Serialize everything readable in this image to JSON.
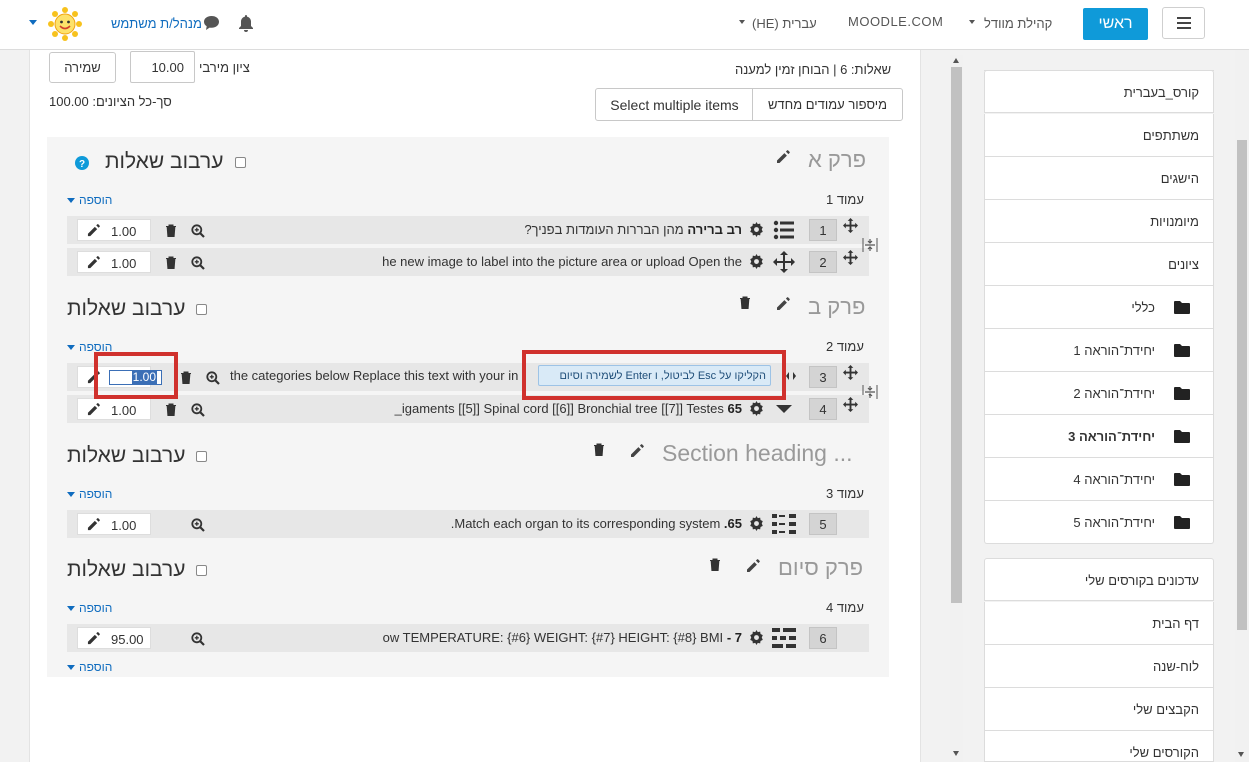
{
  "navbar": {
    "home": "ראשי",
    "community": "קהילת מוודל",
    "moodle_com": "MOODLE.COM",
    "language": "עברית (HE)",
    "user_name": "מנהל/ת משתמש"
  },
  "header": {
    "max_grade_label": "ציון מירבי",
    "max_grade_value": "10.00",
    "save_button": "שמירה",
    "questions_info": "שאלות: 6 | הבוחן זמין למענה",
    "total_marks": "סך-כל הציונים: 100.00",
    "repaginate_button": "מיספור עמודים מחדש",
    "select_multiple_button": "Select multiple items"
  },
  "shuffle_label": "ערבוב שאלות",
  "add_label": "הוספה",
  "sections": [
    {
      "title": "פרק א",
      "page": "עמוד 1"
    },
    {
      "title": "פרק ב",
      "page": "עמוד 2"
    },
    {
      "title": "Section heading ...",
      "page": "עמוד 3"
    },
    {
      "title": "פרק סיום",
      "page": "עמוד 4"
    }
  ],
  "questions": [
    {
      "num": "1",
      "name": "רב ברירה",
      "text": "מהן הבררות העומדות בפניך?",
      "mark": "1.00"
    },
    {
      "num": "2",
      "text": "he new image to label into the picture area or upload Open the",
      "mark": "1.00"
    },
    {
      "num": "3",
      "text": "the categories below Replace this text with your in",
      "mark": "1.00"
    },
    {
      "num": "4",
      "name": "65",
      "text": "igaments  [[5]] Spinal cord  [[6]] Bronchial tree  [[7]] Testes_",
      "mark": "1.00"
    },
    {
      "num": "5",
      "name": "65.",
      "text": "Match each organ to its corresponding system.",
      "mark": "1.00"
    },
    {
      "num": "6",
      "name": "7 -",
      "text": "ow TEMPERATURE: {#6} WEIGHT: {#7} HEIGHT: {#8} BMI",
      "mark": "95.00"
    }
  ],
  "edit_hint": "הקליקו על Esc לביטול, ו Enter לשמירה וסיום",
  "sidebar": {
    "items": [
      "קורס_בעברית",
      "משתתפים",
      "הישגים",
      "מיומנויות",
      "ציונים",
      "כללי",
      "יחידת־הוראה 1",
      "יחידת־הוראה 2",
      "יחידת־הוראה 3",
      "יחידת־הוראה 4",
      "יחידת־הוראה 5"
    ],
    "items2": [
      "עדכונים בקורסים שלי",
      "דף הבית",
      "לוח-שנה",
      "הקבצים שלי",
      "הקורסים שלי"
    ]
  },
  "colors": {
    "accent": "#0f9ad9",
    "highlight": "#d0312d",
    "link": "#0f6cbf"
  }
}
